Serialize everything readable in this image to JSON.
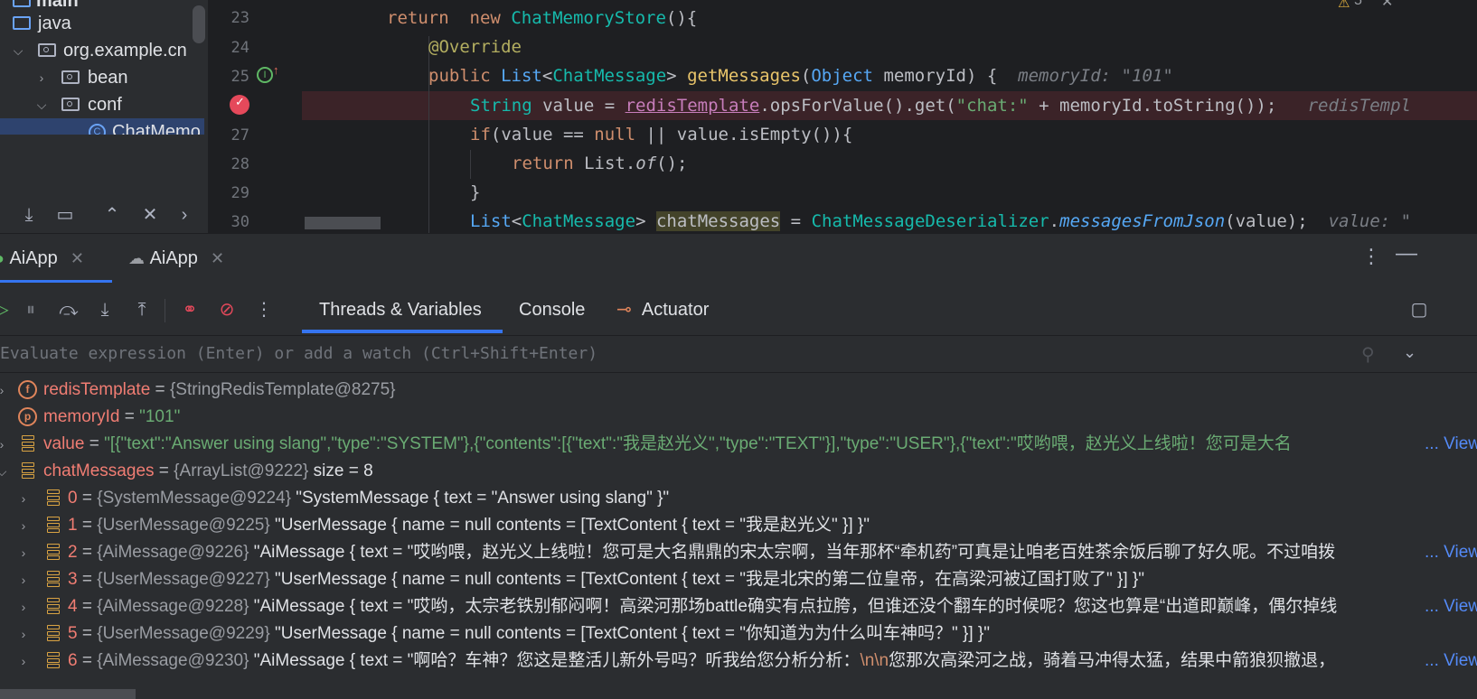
{
  "project_tree": {
    "items": [
      {
        "label": "main",
        "indent": 0
      },
      {
        "label": "java",
        "indent": 1
      },
      {
        "label": "org.example.cn",
        "indent": 2
      },
      {
        "label": "bean",
        "indent": 3
      },
      {
        "label": "conf",
        "indent": 3
      },
      {
        "label": "ChatMemo",
        "indent": 4
      }
    ]
  },
  "editor": {
    "lines": [
      {
        "num": "23"
      },
      {
        "num": "24"
      },
      {
        "num": "25"
      },
      {
        "num": "26"
      },
      {
        "num": "27"
      },
      {
        "num": "28"
      },
      {
        "num": "29"
      },
      {
        "num": "30"
      }
    ],
    "l23": {
      "ret": "return",
      "new": "new",
      "cls": "ChatMemoryStore",
      "rest": "(){"
    },
    "l24": {
      "ann": "@Override"
    },
    "l25": {
      "pub": "public",
      "list": "List",
      "lt": "<",
      "cm": "ChatMessage",
      "gt": ">",
      "fn": "getMessages",
      "p1": "(",
      "obj": "Object",
      "arg": " memoryId) {",
      "hint": "memoryId: \"101\""
    },
    "l26": {
      "str_t": "String",
      "mid": " value = ",
      "field": "redisTemplate",
      "call": ".opsForValue().get(",
      "lit": "\"chat:\"",
      "tail": " + memoryId.toString());",
      "semi": "",
      "hint": "redisTempl"
    },
    "l27": {
      "if": "if",
      "a": "(value == ",
      "nul": "null",
      "b": " || value.isEmpty()){"
    },
    "l28": {
      "ret": "return",
      "a": " List.",
      "of": "of",
      "b": "();"
    },
    "l29": {
      "brace": "}"
    },
    "l30": {
      "list": "List",
      "lt": "<",
      "cm": "ChatMessage",
      "gt": "> ",
      "var": "chatMessages",
      "eq": " = ",
      "cls": "ChatMessageDeserializer",
      "dot": ".",
      "fn": "messagesFromJson",
      "tail": "(value);",
      "hint": "value: \""
    }
  },
  "warnings": {
    "count": "5"
  },
  "run_tabs": [
    {
      "label": "AiApp"
    },
    {
      "label": "AiApp"
    }
  ],
  "debug_tabs": {
    "threads": "Threads & Variables",
    "console": "Console",
    "actuator": "Actuator"
  },
  "evaluate": {
    "placeholder": "Evaluate expression (Enter) or add a watch (Ctrl+Shift+Enter)"
  },
  "variables": [
    {
      "name": "redisTemplate",
      "eq": " = ",
      "type": "{StringRedisTemplate@8275}",
      "icon": "f"
    },
    {
      "name": "memoryId",
      "eq": " = ",
      "str": "\"101\"",
      "icon": "p"
    },
    {
      "name": "value",
      "eq": " = ",
      "str": "\"[{\"text\":\"Answer using slang\",\"type\":\"SYSTEM\"},{\"contents\":[{\"text\":\"我是赵光义\",\"type\":\"TEXT\"}],\"type\":\"USER\"},{\"text\":\"哎哟喂，赵光义上线啦！您可是大名",
      "more": "... View"
    },
    {
      "name": "chatMessages",
      "eq": " = ",
      "type": "{ArrayList@9222}",
      "extra": "  size = 8"
    },
    {
      "idx": "0",
      "eq": " = ",
      "type": "{SystemMessage@9224}",
      "val": " \"SystemMessage { text = \"Answer using slang\" }\""
    },
    {
      "idx": "1",
      "eq": " = ",
      "type": "{UserMessage@9225}",
      "val": " \"UserMessage { name = null contents = [TextContent { text = \"我是赵光义\" }] }\""
    },
    {
      "idx": "2",
      "eq": " = ",
      "type": "{AiMessage@9226}",
      "val": " \"AiMessage { text = \"哎哟喂，赵光义上线啦！您可是大名鼎鼎的宋太宗啊，当年那杯“牵机药”可真是让咱老百姓茶余饭后聊了好久呢。不过咱拨",
      "more": "... View"
    },
    {
      "idx": "3",
      "eq": " = ",
      "type": "{UserMessage@9227}",
      "val": " \"UserMessage { name = null contents = [TextContent { text = \"我是北宋的第二位皇帝，在高梁河被辽国打败了\" }] }\""
    },
    {
      "idx": "4",
      "eq": " = ",
      "type": "{AiMessage@9228}",
      "val": " \"AiMessage { text = \"哎哟，太宗老铁别郁闷啊！高梁河那场battle确实有点拉胯，但谁还没个翻车的时候呢？您这也算是“出道即巅峰，偶尔掉线",
      "more": "... View"
    },
    {
      "idx": "5",
      "eq": " = ",
      "type": "{UserMessage@9229}",
      "val": " \"UserMessage { name = null contents = [TextContent { text = \"你知道为为什么叫车神吗？\" }] }\""
    },
    {
      "idx": "6",
      "eq": " = ",
      "type": "{AiMessage@9230}",
      "val": " \"AiMessage { text = \"啊哈？车神？您这是整活儿新外号吗？听我给您分析分析：",
      "esc": "\\n\\n",
      "val2": "您那次高梁河之战，骑着马冲得太猛，结果中箭狼狈撤退，",
      "more": "... View"
    }
  ]
}
